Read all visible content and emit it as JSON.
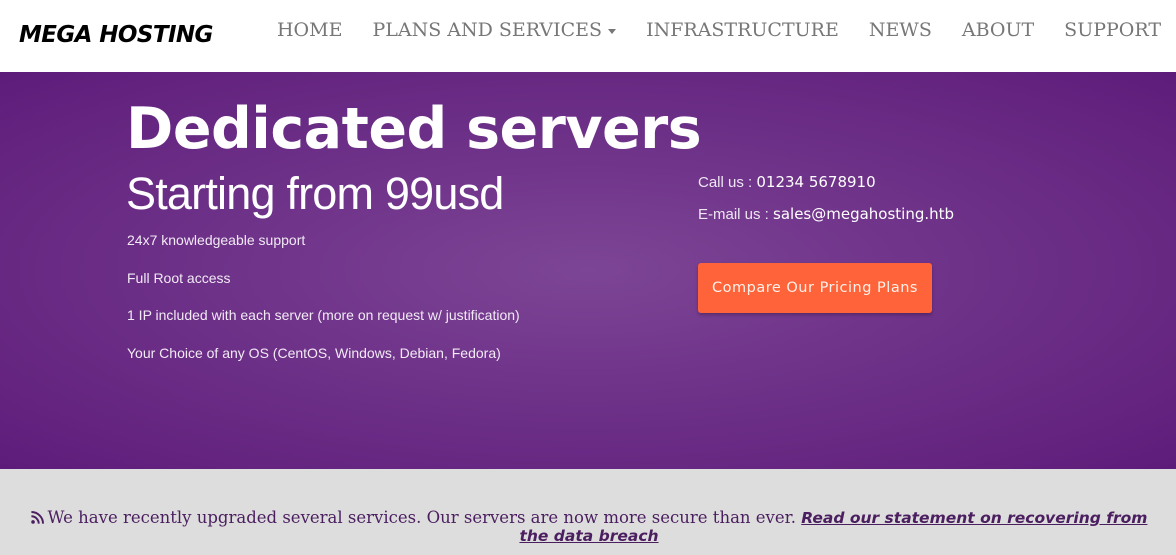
{
  "brand": "MEGA HOSTING",
  "nav": {
    "items": [
      {
        "label": "HOME"
      },
      {
        "label": "PLANS AND SERVICES",
        "dropdown": true
      },
      {
        "label": "INFRASTRUCTURE"
      },
      {
        "label": "NEWS"
      },
      {
        "label": "ABOUT"
      },
      {
        "label": "SUPPORT"
      }
    ]
  },
  "hero": {
    "title": "Dedicated servers",
    "subtitle": "Starting from 99usd",
    "features": [
      "24x7 knowledgeable support",
      "Full Root access",
      "1 IP included with each server (more on request w/ justification)",
      "Your Choice of any OS (CentOS, Windows, Debian, Fedora)"
    ],
    "contact": {
      "phone_label": "Call us : ",
      "phone": "01234 5678910",
      "email_label": "E-mail us : ",
      "email": "sales@megahosting.htb"
    },
    "cta_label": "Compare Our Pricing Plans"
  },
  "notice": {
    "icon": "rss-icon",
    "text": "We have recently upgraded several services. Our servers are now more secure than ever. ",
    "link_text": "Read our statement on recovering from the data breach"
  },
  "colors": {
    "hero_bg": "#6e3289",
    "cta_bg": "#ff6339",
    "notice_bg": "#dddddd",
    "notice_text": "#4b1e5f",
    "nav_text": "#777777"
  }
}
